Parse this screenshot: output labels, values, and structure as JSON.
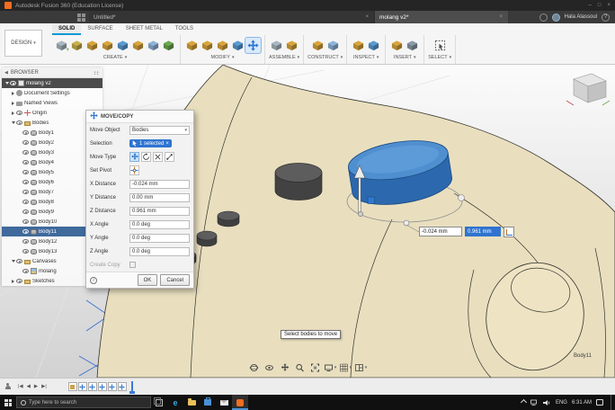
{
  "colors": {
    "accent_tab": "#0a99d5",
    "selection_blue": "#2f74d0",
    "model_cream": "#e9dfbf",
    "cylinder_blue": "#4f8fd0",
    "taskbar_black": "#101010"
  },
  "glyphs": {
    "caret": "▾",
    "close": "×",
    "collapse": "◀",
    "info": "i",
    "help": "?",
    "min": "–",
    "max": "□",
    "plus": "+"
  },
  "titlebar": {
    "title": "Autodesk Fusion 360 (Education License)"
  },
  "tabbar": {
    "tabs": [
      {
        "label": "Untitled*"
      },
      {
        "label": "molang v2*"
      }
    ],
    "user": "Hala Alassoul"
  },
  "ribbon": {
    "design_label": "DESIGN",
    "tabs": [
      {
        "label": "SOLID"
      },
      {
        "label": "SURFACE"
      },
      {
        "label": "SHEET METAL"
      },
      {
        "label": "TOOLS"
      }
    ],
    "groups": [
      {
        "label": "CREATE",
        "icons": [
          {
            "name": "new-component-icon",
            "c": "#a9b7c0",
            "badge": true
          },
          {
            "name": "create-sketch-icon",
            "c": "#c8b24a"
          },
          {
            "name": "extrude-icon",
            "c": "#d9a53b"
          },
          {
            "name": "revolve-icon",
            "c": "#d9a53b"
          },
          {
            "name": "sweep-icon",
            "c": "#5a9bd4"
          },
          {
            "name": "primitive-box-icon",
            "c": "#d9a53b"
          },
          {
            "name": "primitive-cylinder-icon",
            "c": "#8fb4d9"
          },
          {
            "name": "pattern-icon",
            "c": "#6aa84f"
          }
        ]
      },
      {
        "label": "MODIFY",
        "icons": [
          {
            "name": "press-pull-icon",
            "c": "#d9a53b"
          },
          {
            "name": "fillet-icon",
            "c": "#d9a53b"
          },
          {
            "name": "shell-icon",
            "c": "#d9a53b"
          },
          {
            "name": "combine-icon",
            "c": "#5a9bd4"
          },
          {
            "name": "move-copy-icon",
            "type": "move",
            "c": "#2f74d0",
            "active": true
          }
        ]
      },
      {
        "label": "ASSEMBLE",
        "icons": [
          {
            "name": "assemble-new-component-icon",
            "c": "#a9b7c0"
          },
          {
            "name": "joint-icon",
            "c": "#d9a53b"
          }
        ]
      },
      {
        "label": "CONSTRUCT",
        "icons": [
          {
            "name": "offset-plane-icon",
            "c": "#d9a53b"
          },
          {
            "name": "construct-axis-icon",
            "c": "#8fb4d9"
          }
        ]
      },
      {
        "label": "INSPECT",
        "icons": [
          {
            "name": "measure-icon",
            "c": "#d9a53b"
          },
          {
            "name": "section-analysis-icon",
            "c": "#5a9bd4"
          }
        ]
      },
      {
        "label": "INSERT",
        "icons": [
          {
            "name": "decal-icon",
            "c": "#d9a53b"
          },
          {
            "name": "insert-mesh-icon",
            "c": "#8a9aa8"
          }
        ]
      },
      {
        "label": "SELECT",
        "icons": [
          {
            "name": "select-icon",
            "type": "select"
          }
        ]
      }
    ]
  },
  "browser": {
    "header": "BROWSER",
    "items": [
      {
        "label": "molang v2",
        "depth": 0,
        "arrow": "down",
        "eye": true,
        "icon": "doc",
        "sel": "root"
      },
      {
        "label": "Document Settings",
        "depth": 1,
        "arrow": "right",
        "eye": false,
        "icon": "gear"
      },
      {
        "label": "Named Views",
        "depth": 1,
        "arrow": "right",
        "eye": false,
        "icon": "camera"
      },
      {
        "label": "Origin",
        "depth": 1,
        "arrow": "right",
        "eye": true,
        "icon": "origin"
      },
      {
        "label": "Bodies",
        "depth": 1,
        "arrow": "down",
        "eye": true,
        "icon": "folder"
      },
      {
        "label": "Body1",
        "depth": 2,
        "eye": true,
        "icon": "body"
      },
      {
        "label": "Body2",
        "depth": 2,
        "eye": true,
        "icon": "body"
      },
      {
        "label": "Body3",
        "depth": 2,
        "eye": true,
        "icon": "body"
      },
      {
        "label": "Body4",
        "depth": 2,
        "eye": true,
        "icon": "body"
      },
      {
        "label": "Body5",
        "depth": 2,
        "eye": true,
        "icon": "body"
      },
      {
        "label": "Body6",
        "depth": 2,
        "eye": true,
        "icon": "body"
      },
      {
        "label": "Body7",
        "depth": 2,
        "eye": true,
        "icon": "body"
      },
      {
        "label": "Body8",
        "depth": 2,
        "eye": true,
        "icon": "body"
      },
      {
        "label": "Body9",
        "depth": 2,
        "eye": true,
        "icon": "body"
      },
      {
        "label": "Body10",
        "depth": 2,
        "eye": true,
        "icon": "body"
      },
      {
        "label": "Body11",
        "depth": 2,
        "eye": true,
        "icon": "body",
        "sel": "body"
      },
      {
        "label": "Body12",
        "depth": 2,
        "eye": true,
        "icon": "body"
      },
      {
        "label": "Body13",
        "depth": 2,
        "eye": true,
        "icon": "body"
      },
      {
        "label": "Canvases",
        "depth": 1,
        "arrow": "down",
        "eye": true,
        "icon": "folder"
      },
      {
        "label": "molang",
        "depth": 2,
        "eye": true,
        "icon": "canvas"
      },
      {
        "label": "Sketches",
        "depth": 1,
        "arrow": "right",
        "eye": true,
        "icon": "folder"
      }
    ]
  },
  "dialog": {
    "title": "MOVE/COPY",
    "move_object_label": "Move Object",
    "move_object_value": "Bodies",
    "selection_label": "Selection",
    "selection_value": "1 selected",
    "move_type_label": "Move Type",
    "set_pivot_label": "Set Pivot",
    "fields": [
      {
        "label": "X Distance",
        "value": "-0.024 mm"
      },
      {
        "label": "Y Distance",
        "value": "0.00 mm"
      },
      {
        "label": "Z Distance",
        "value": "0.961 mm"
      },
      {
        "label": "X Angle",
        "value": "0.0 deg"
      },
      {
        "label": "Y Angle",
        "value": "0.0 deg"
      },
      {
        "label": "Z Angle",
        "value": "0.0 deg"
      }
    ],
    "create_copy_label": "Create Copy",
    "ok_label": "OK",
    "cancel_label": "Cancel"
  },
  "viewport": {
    "inputs": [
      {
        "value": "-0.024 mm"
      },
      {
        "value": "0.961 mm"
      }
    ],
    "tooltip": "Select bodies to move",
    "body_label": "Body11"
  },
  "timeline": {
    "controls": [
      "|◀",
      "◀",
      "▶",
      "▶|"
    ],
    "features": [
      "sketch",
      "move",
      "move",
      "move",
      "move",
      "move"
    ]
  },
  "taskbar": {
    "search_placeholder": "Type here to search",
    "language": "ENG",
    "time": "6:31 AM",
    "edge_glyph": "e"
  }
}
